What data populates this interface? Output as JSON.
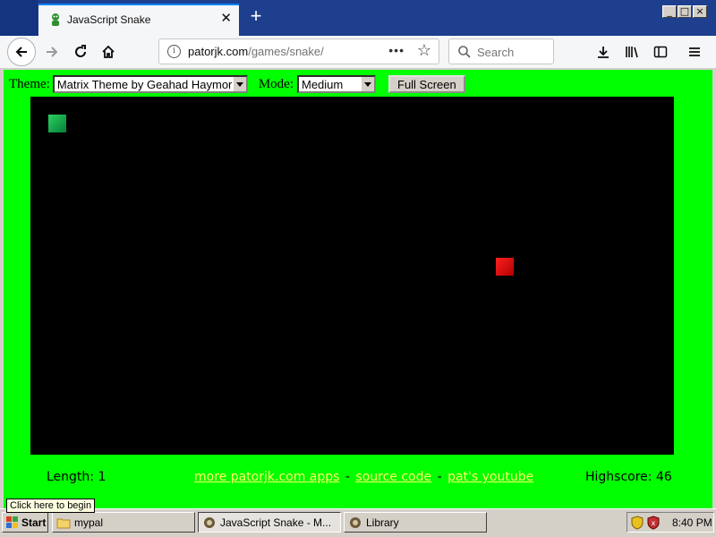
{
  "browser": {
    "tab_title": "JavaScript Snake",
    "tab_close": "✕",
    "new_tab": "+",
    "url_domain": "patorjk.com",
    "url_path": "/games/snake/",
    "search_placeholder": "Search",
    "page_actions": "•••",
    "window_buttons": [
      "_",
      "□",
      "×"
    ]
  },
  "game": {
    "theme_label": "Theme:",
    "theme_value": "Matrix Theme by Geahad Haymor",
    "mode_label": "Mode:",
    "mode_value": "Medium",
    "fullscreen_label": "Full Screen",
    "length_text": "Length: 1",
    "highscore_text": "Highscore: 46",
    "links": [
      "more patorjk.com apps",
      "source code",
      "pat's youtube"
    ],
    "link_separator": "-"
  },
  "taskbar": {
    "start_label": "Start",
    "tooltip": "Click here to begin",
    "windows": [
      "mypal",
      "JavaScript Snake - M...",
      "Library"
    ],
    "clock": "8:40 PM"
  },
  "colors": {
    "page_background": "#00ff00",
    "board": "#000000",
    "snake": "#00a040",
    "food": "#e00000",
    "link": "#ffff66"
  }
}
